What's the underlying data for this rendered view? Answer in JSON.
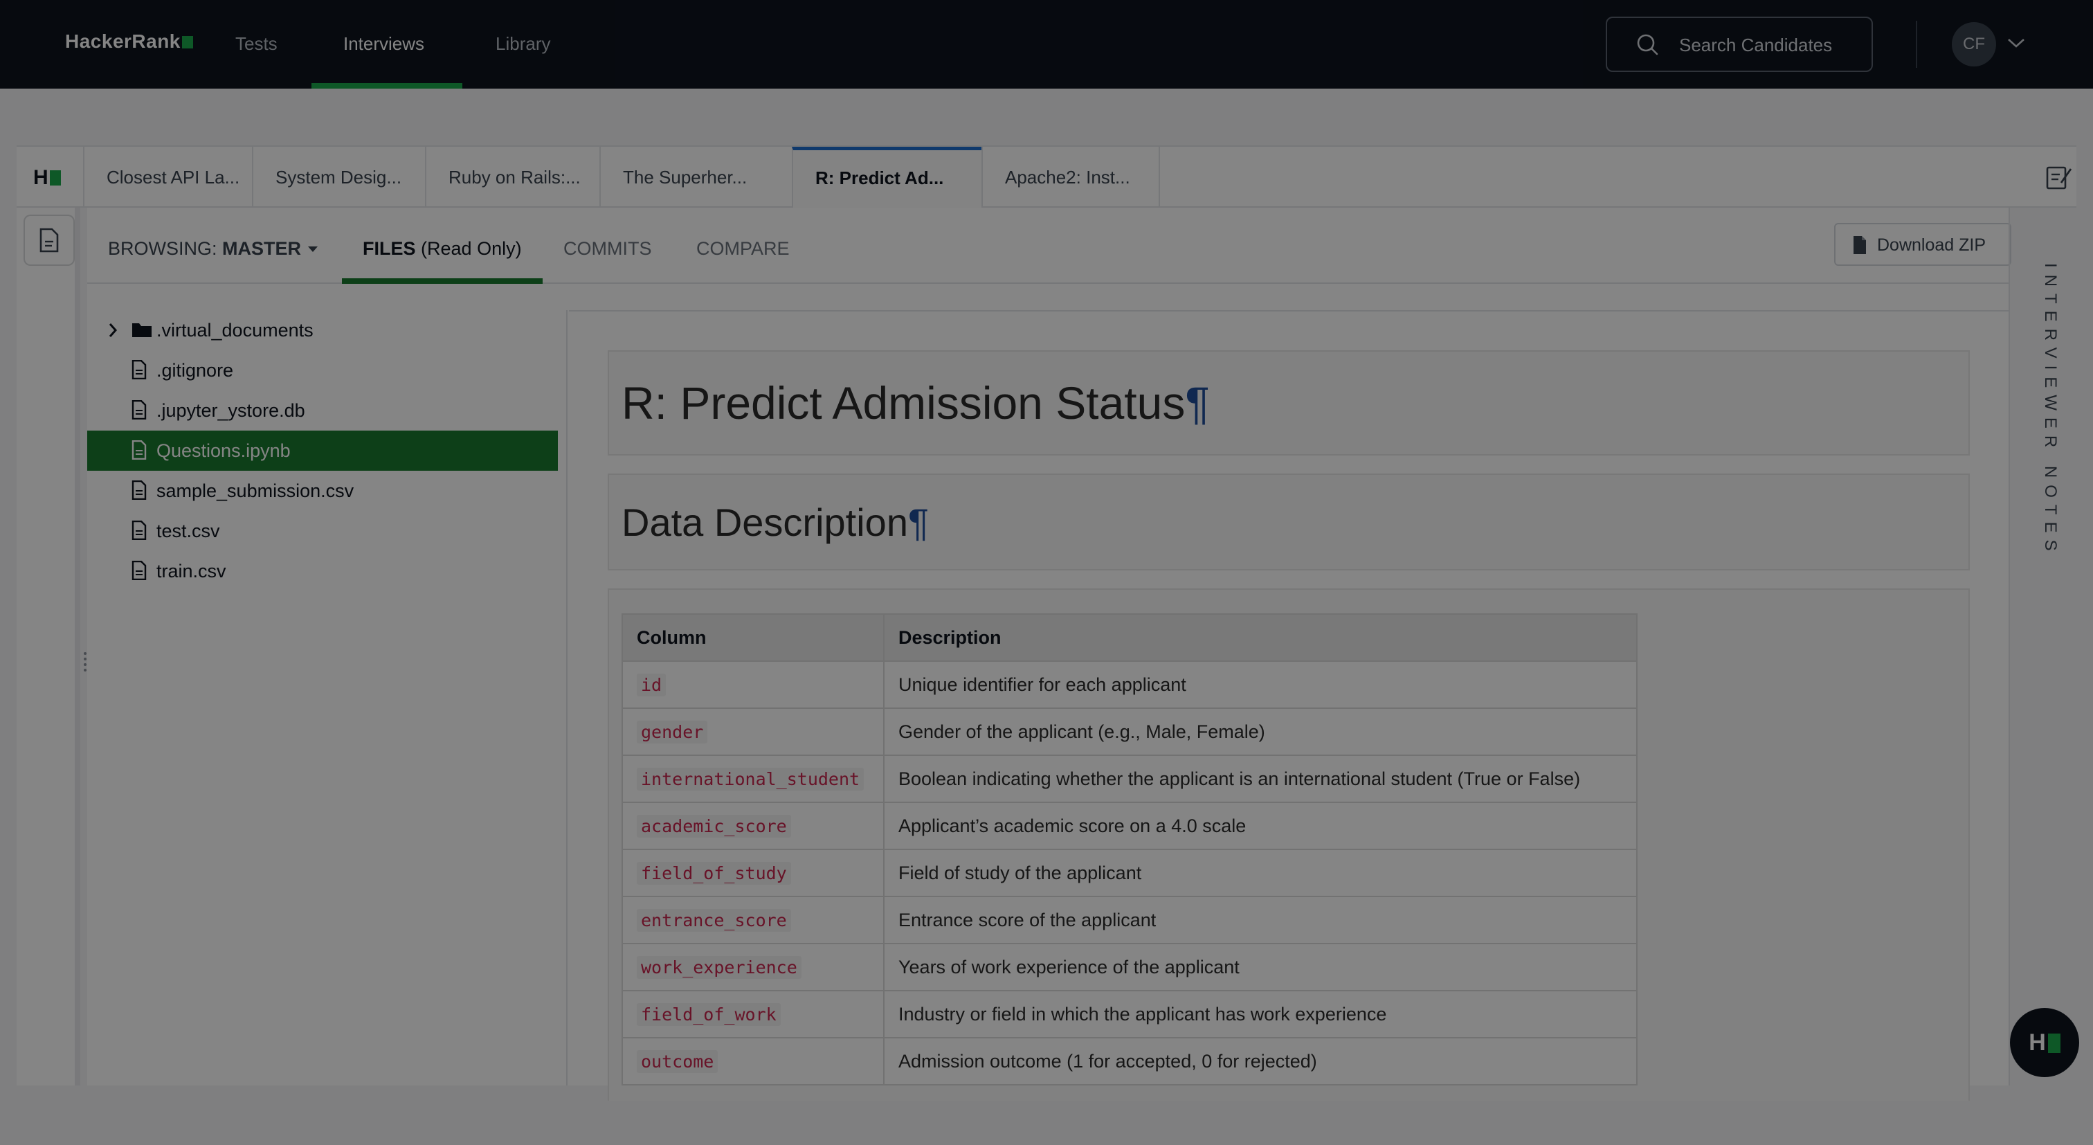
{
  "topnav": {
    "logo_text": "HackerRank",
    "links": [
      "Tests",
      "Interviews",
      "Library"
    ],
    "active_link": "Interviews",
    "search_placeholder": "Search Candidates",
    "avatar_initials": "CF"
  },
  "tabs": {
    "items": [
      "Closest API La...",
      "System Desig...",
      "Ruby on Rails:...",
      "The Superher...",
      "R: Predict Ad...",
      "Apache2: Inst..."
    ],
    "active": "R: Predict Ad..."
  },
  "subnav": {
    "browsing_label": "BROWSING:",
    "branch": "MASTER",
    "files_label": "FILES",
    "files_suffix": "(Read Only)",
    "commits_label": "COMMITS",
    "compare_label": "COMPARE",
    "download_label": "Download ZIP"
  },
  "tree": {
    "items": [
      {
        "type": "folder",
        "name": ".virtual_documents"
      },
      {
        "type": "file",
        "name": ".gitignore"
      },
      {
        "type": "file",
        "name": ".jupyter_ystore.db"
      },
      {
        "type": "file",
        "name": "Questions.ipynb"
      },
      {
        "type": "file",
        "name": "sample_submission.csv"
      },
      {
        "type": "file",
        "name": "test.csv"
      },
      {
        "type": "file",
        "name": "train.csv"
      }
    ],
    "selected": "Questions.ipynb"
  },
  "notebook": {
    "title": "R: Predict Admission Status",
    "section": "Data Description",
    "pilcrow": "¶",
    "table": {
      "headers": [
        "Column",
        "Description"
      ],
      "rows": [
        [
          "id",
          "Unique identifier for each applicant"
        ],
        [
          "gender",
          "Gender of the applicant (e.g., Male, Female)"
        ],
        [
          "international_student",
          "Boolean indicating whether the applicant is an international student (True or False)"
        ],
        [
          "academic_score",
          "Applicant’s academic score on a 4.0 scale"
        ],
        [
          "field_of_study",
          "Field of study of the applicant"
        ],
        [
          "entrance_score",
          "Entrance score of the applicant"
        ],
        [
          "work_experience",
          "Years of work experience of the applicant"
        ],
        [
          "field_of_work",
          "Industry or field in which the applicant has work experience"
        ],
        [
          "outcome",
          "Admission outcome (1 for accepted, 0 for rejected)"
        ]
      ]
    }
  },
  "notes_label": "INTERVIEWER NOTES",
  "colors": {
    "nav_bg": "#0e141e",
    "brand_green": "#1ba94c",
    "selected_green": "#1a7a2e",
    "active_tab_accent": "#1e6ecf",
    "code_red": "#c7254e"
  },
  "icons": [
    "search-icon",
    "chevron-down-icon",
    "file-icon",
    "folder-icon",
    "chevron-right-icon",
    "notes-icon",
    "download-file-icon"
  ]
}
